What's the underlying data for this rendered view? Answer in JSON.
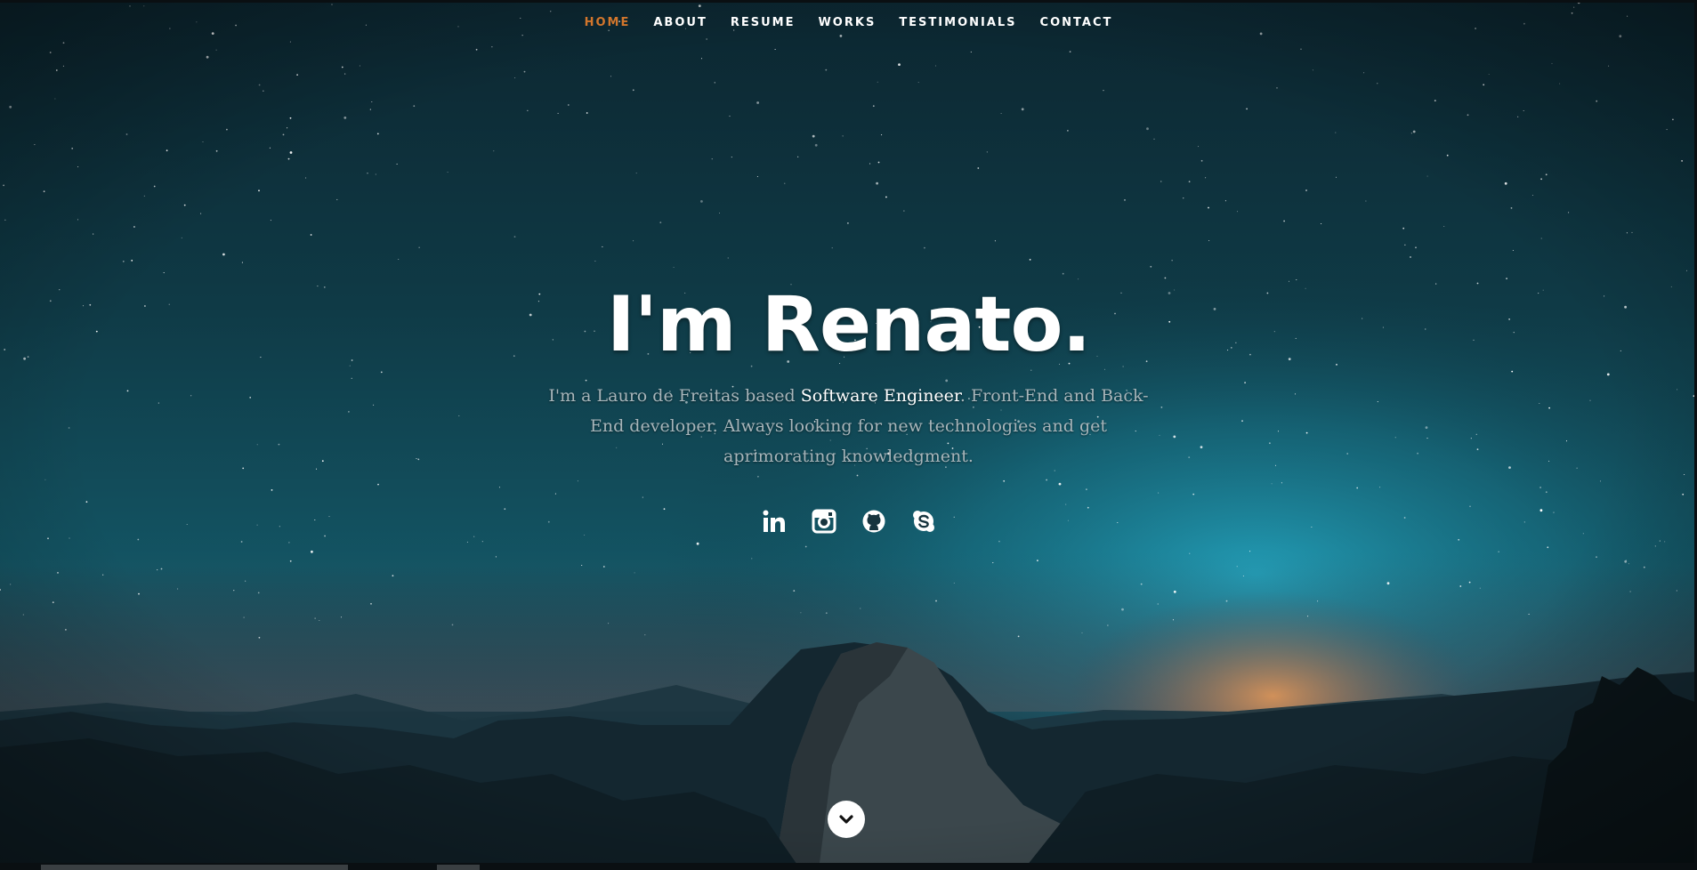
{
  "nav": {
    "items": [
      {
        "label": "HOME",
        "active": true
      },
      {
        "label": "ABOUT",
        "active": false
      },
      {
        "label": "RESUME",
        "active": false
      },
      {
        "label": "WORKS",
        "active": false
      },
      {
        "label": "TESTIMONIALS",
        "active": false
      },
      {
        "label": "CONTACT",
        "active": false
      }
    ],
    "active_color": "#d2762c",
    "text_color": "#ffffff"
  },
  "hero": {
    "title": "I'm Renato.",
    "description_before": "I'm a Lauro de Freitas based ",
    "description_highlight": "Software Engineer",
    "description_after": ". Front-End and Back-End developer. Always looking for new technologies and get aprimorating knowledgment."
  },
  "social": {
    "icons": [
      "linkedin-icon",
      "instagram-icon",
      "github-icon",
      "skype-icon"
    ]
  },
  "scroll": {
    "icon": "chevron-down-icon"
  },
  "colors": {
    "sky_top": "#0d2a33",
    "sky_glow": "#1f8fa5",
    "horizon_glow": "#d98a52",
    "mountains": "#0e1a20"
  }
}
